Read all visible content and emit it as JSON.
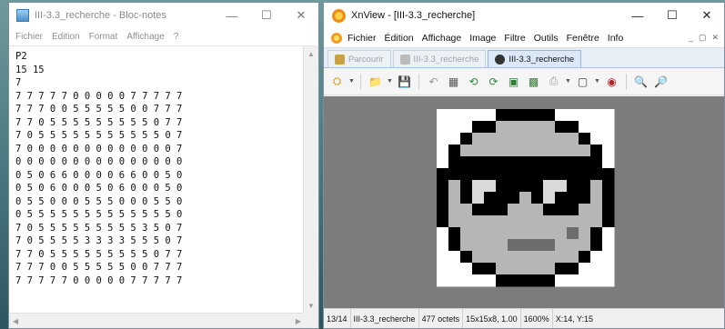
{
  "notepad": {
    "title": "III-3.3_recherche - Bloc-notes",
    "menu": [
      "Fichier",
      "Edition",
      "Format",
      "Affichage",
      "?"
    ],
    "lines": [
      "P2",
      "15 15",
      "7",
      "7 7 7 7 7 0 0 0 0 0 7 7 7 7 7",
      "7 7 7 0 0 5 5 5 5 5 0 0 7 7 7",
      "7 7 0 5 5 5 5 5 5 5 5 5 0 7 7",
      "7 0 5 5 5 5 5 5 5 5 5 5 5 0 7",
      "7 0 0 0 0 0 0 0 0 0 0 0 0 0 7",
      "0 0 0 0 0 0 0 0 0 0 0 0 0 0 0",
      "0 5 0 6 6 0 0 0 0 6 6 0 0 5 0",
      "0 5 0 6 0 0 0 5 0 6 0 0 0 5 0",
      "0 5 5 0 0 0 5 5 5 0 0 0 5 5 0",
      "0 5 5 5 5 5 5 5 5 5 5 5 5 5 0",
      "7 0 5 5 5 5 5 5 5 5 5 3 5 0 7",
      "7 0 5 5 5 5 3 3 3 3 5 5 5 0 7",
      "7 7 0 5 5 5 5 5 5 5 5 5 0 7 7",
      "7 7 7 0 0 5 5 5 5 5 0 0 7 7 7",
      "7 7 7 7 7 0 0 0 0 0 7 7 7 7 7"
    ]
  },
  "xnview": {
    "title": "XnView - [III-3.3_recherche]",
    "menu": [
      "Fichier",
      "Édition",
      "Affichage",
      "Image",
      "Filtre",
      "Outils",
      "Fenêtre",
      "Info"
    ],
    "tabs": [
      {
        "label": "Parcourir",
        "active": false
      },
      {
        "label": "III-3.3_recherche",
        "active": false
      },
      {
        "label": "III-3.3_recherche",
        "active": true
      }
    ],
    "status": {
      "index": "13/14",
      "filename": "III-3.3_recherche",
      "size": "477 octets",
      "dims": "15x15x8, 1.00",
      "zoom": "1600%",
      "coords": "X:14, Y:15"
    },
    "image_background": "#7c7c7c",
    "palette": {
      "0": "#000000",
      "3": "#6d6d6d",
      "5": "#b6b6b6",
      "6": "#dadada",
      "7": "#ffffff"
    }
  }
}
